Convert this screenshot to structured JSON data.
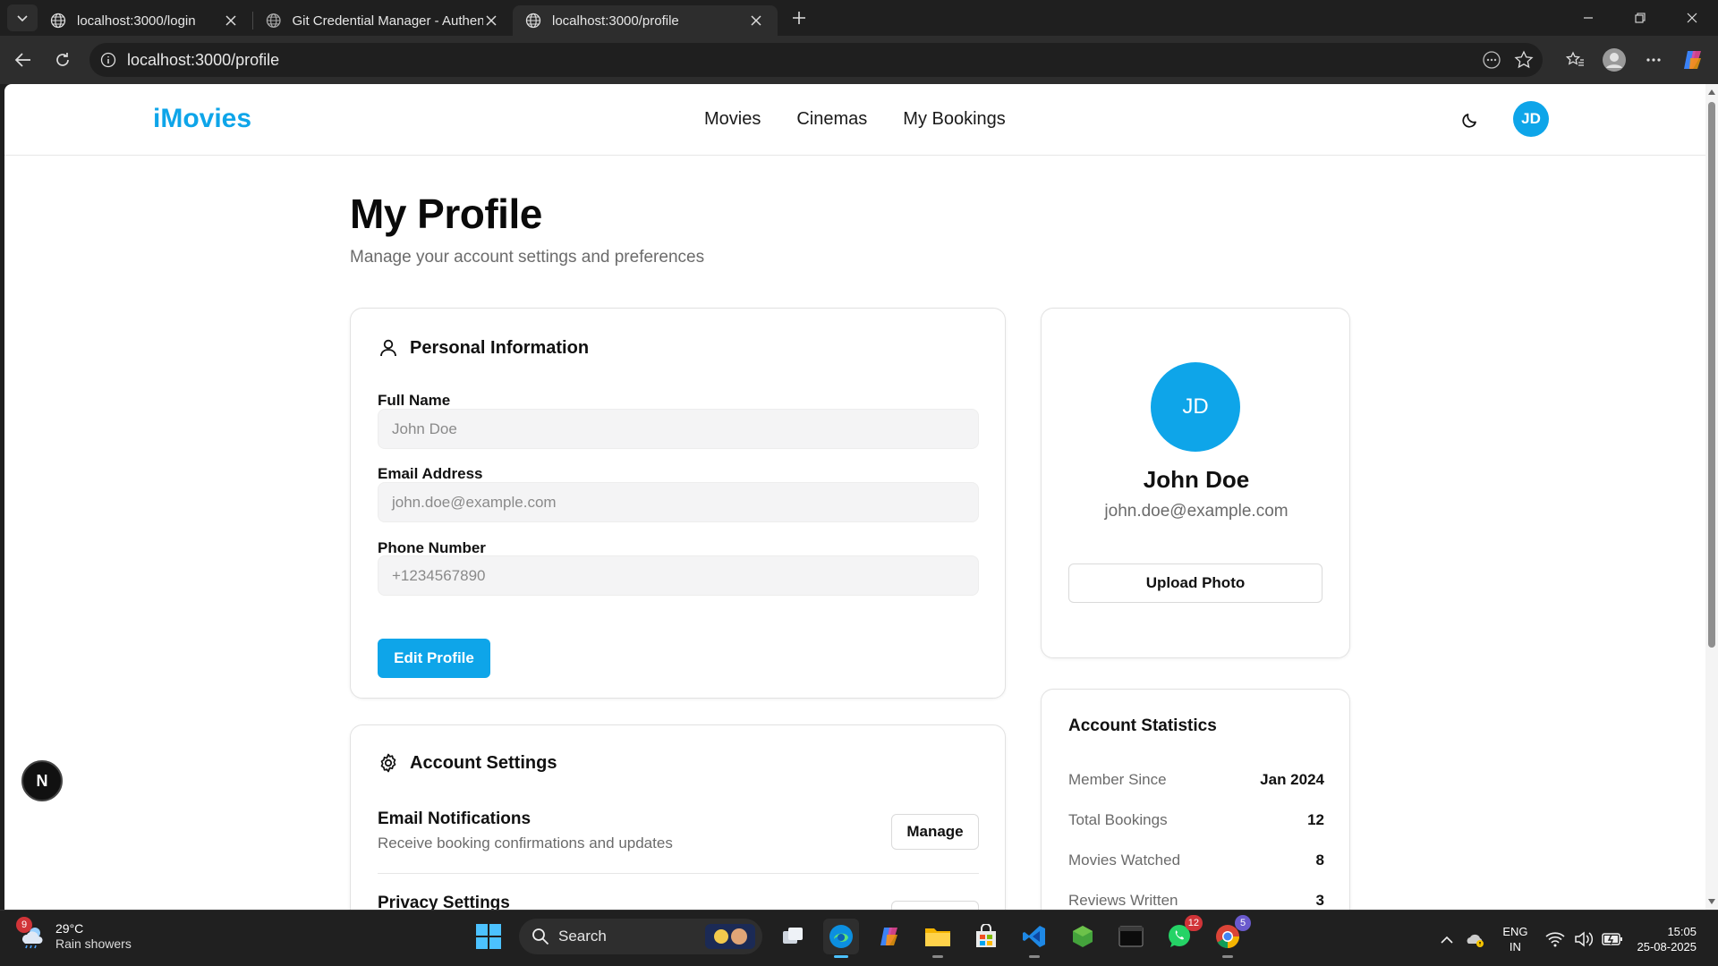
{
  "browser": {
    "tabs": [
      {
        "title": "localhost:3000/login",
        "active": false
      },
      {
        "title": "Git Credential Manager - Authent",
        "active": false
      },
      {
        "title": "localhost:3000/profile",
        "active": true
      }
    ],
    "url": "localhost:3000/profile"
  },
  "site": {
    "logo": "iMovies",
    "nav": [
      "Movies",
      "Cinemas",
      "My Bookings"
    ],
    "avatar_initials": "JD",
    "accent_color": "#0ea5e9"
  },
  "page": {
    "title": "My Profile",
    "subtitle": "Manage your account settings and preferences"
  },
  "personal_info": {
    "heading": "Personal Information",
    "fields": [
      {
        "label": "Full Name",
        "placeholder": "John Doe"
      },
      {
        "label": "Email Address",
        "placeholder": "john.doe@example.com"
      },
      {
        "label": "Phone Number",
        "placeholder": "+1234567890"
      }
    ],
    "edit_button": "Edit Profile"
  },
  "account_settings": {
    "heading": "Account Settings",
    "items": [
      {
        "title": "Email Notifications",
        "description": "Receive booking confirmations and updates",
        "button": "Manage"
      },
      {
        "title": "Privacy Settings",
        "description": "",
        "button": ""
      }
    ]
  },
  "profile_card": {
    "initials": "JD",
    "name": "John Doe",
    "email": "john.doe@example.com",
    "upload_button": "Upload Photo"
  },
  "stats": {
    "heading": "Account Statistics",
    "rows": [
      {
        "label": "Member Since",
        "value": "Jan 2024"
      },
      {
        "label": "Total Bookings",
        "value": "12"
      },
      {
        "label": "Movies Watched",
        "value": "8"
      },
      {
        "label": "Reviews Written",
        "value": "3"
      }
    ]
  },
  "dev_badge": "N",
  "taskbar": {
    "weather_badge": "9",
    "temperature": "29°C",
    "condition": "Rain showers",
    "search_label": "Search",
    "whatsapp_badge": "12",
    "chrome_badge": "5",
    "lang_line1": "ENG",
    "lang_line2": "IN",
    "time": "15:05",
    "date": "25-08-2025"
  }
}
